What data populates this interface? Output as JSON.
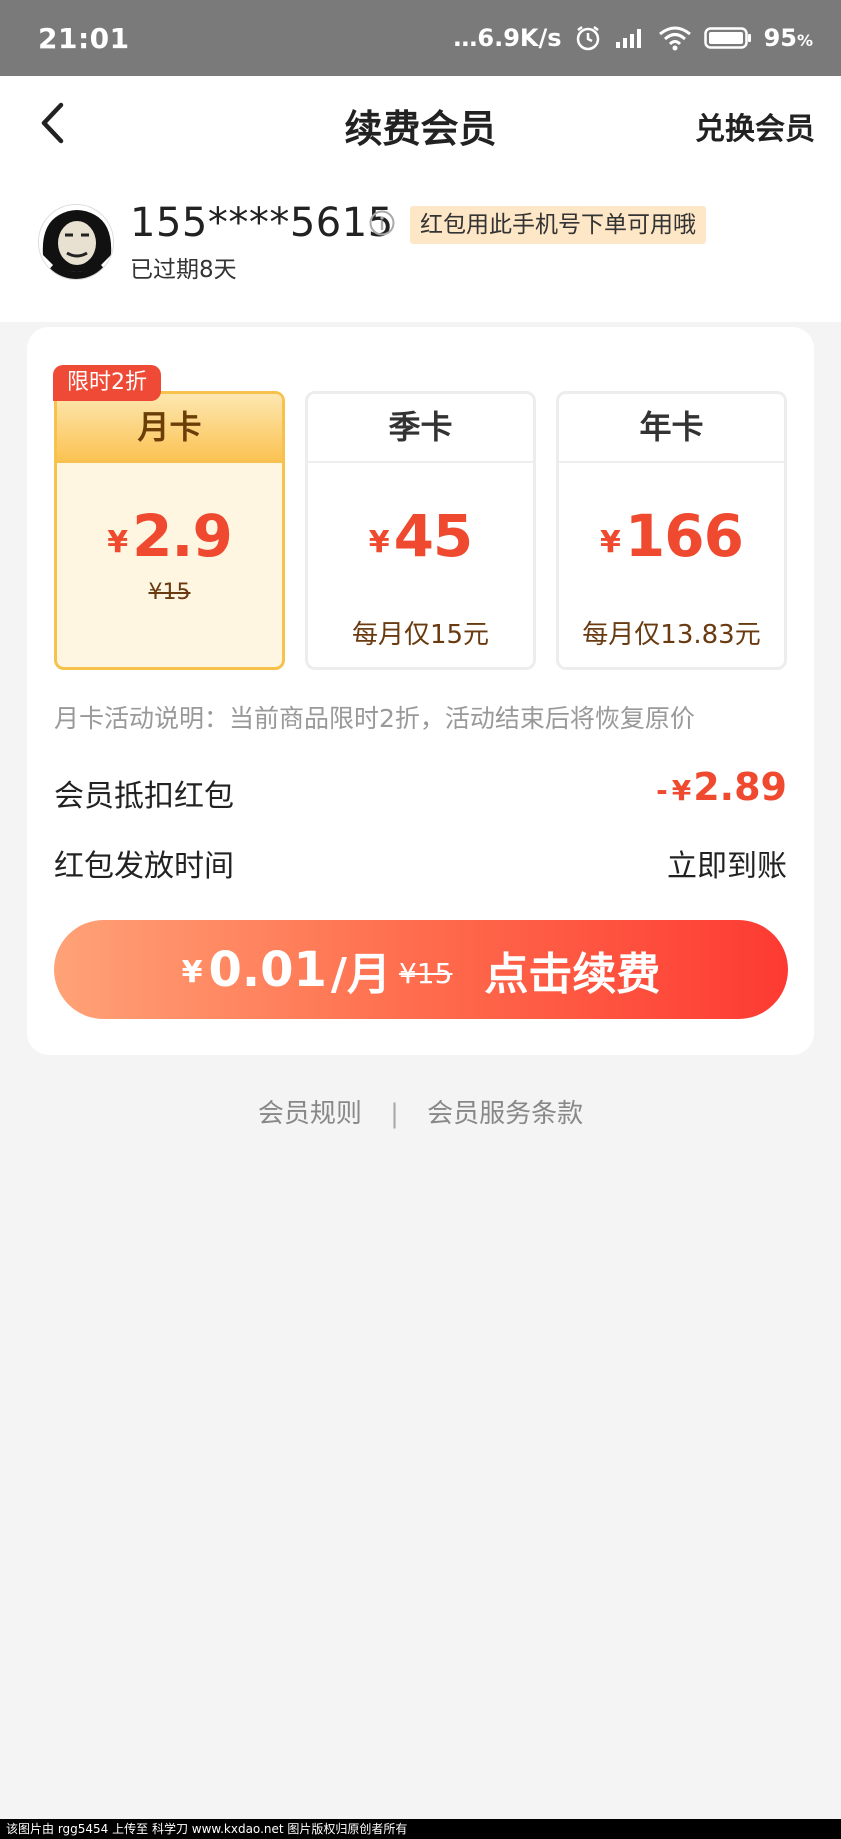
{
  "status_bar": {
    "time": "21:01",
    "net_speed": "…6.9K/s",
    "battery": "95",
    "battery_unit": "%"
  },
  "header": {
    "title": "续费会员",
    "redeem_label": "兑换会员"
  },
  "user": {
    "phone": "155****5615",
    "tip": "红包用此手机号下单可用哦",
    "expired": "已过期8天"
  },
  "plans": [
    {
      "name": "月卡",
      "currency": "¥",
      "price": "2.9",
      "original": "¥15",
      "badge": "限时2折",
      "selected": true
    },
    {
      "name": "季卡",
      "currency": "¥",
      "price": "45",
      "per_month": "每月仅15元",
      "selected": false
    },
    {
      "name": "年卡",
      "currency": "¥",
      "price": "166",
      "per_month": "每月仅13.83元",
      "selected": false
    }
  ],
  "note": "月卡活动说明：当前商品限时2折，活动结束后将恢复原价",
  "deduction": {
    "label": "会员抵扣红包",
    "minus": "-",
    "currency": "¥",
    "value": "2.89"
  },
  "issue_time": {
    "label": "红包发放时间",
    "value": "立即到账"
  },
  "cta": {
    "currency": "¥",
    "amount": "0.01",
    "per": "/月",
    "original": "¥15",
    "label": "点击续费"
  },
  "footer": {
    "rules": "会员规则",
    "separator": "|",
    "terms": "会员服务条款"
  },
  "watermark": "该图片由 rgg5454 上传至 科学刀 www.kxdao.net 图片版权归原创者所有",
  "colors": {
    "accent": "#ef4a2f",
    "gold": "#fbc252",
    "bg": "#f4f4f4"
  }
}
